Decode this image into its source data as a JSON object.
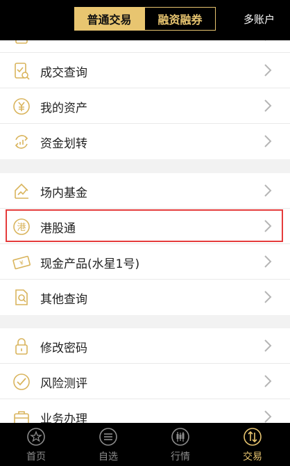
{
  "colors": {
    "accent": "#e8c570",
    "header_bg": "#000000",
    "highlight": "#e53b3b"
  },
  "header": {
    "segments": [
      {
        "label": "普通交易",
        "active": true
      },
      {
        "label": "融资融券",
        "active": false
      }
    ],
    "multi_account_label": "多账户"
  },
  "groups": [
    {
      "items": [
        {
          "label": "",
          "icon": "document-icon"
        },
        {
          "label": "成交查询",
          "icon": "query-icon"
        },
        {
          "label": "我的资产",
          "icon": "yuan-icon"
        },
        {
          "label": "资金划转",
          "icon": "transfer-icon"
        }
      ]
    },
    {
      "items": [
        {
          "label": "场内基金",
          "icon": "fund-icon"
        },
        {
          "label": "港股通",
          "icon": "hk-icon"
        },
        {
          "label": "现金产品(水星1号)",
          "icon": "cash-icon"
        },
        {
          "label": "其他查询",
          "icon": "search-doc-icon"
        }
      ]
    },
    {
      "items": [
        {
          "label": "修改密码",
          "icon": "lock-icon"
        },
        {
          "label": "风险测评",
          "icon": "check-icon"
        },
        {
          "label": "业务办理",
          "icon": "briefcase-icon"
        }
      ]
    }
  ],
  "highlighted_item": "港股通",
  "tabbar": {
    "tabs": [
      {
        "label": "首页",
        "icon": "star-icon",
        "active": false
      },
      {
        "label": "自选",
        "icon": "list-icon",
        "active": false
      },
      {
        "label": "行情",
        "icon": "candlestick-icon",
        "active": false
      },
      {
        "label": "交易",
        "icon": "trade-icon",
        "active": true
      }
    ]
  }
}
